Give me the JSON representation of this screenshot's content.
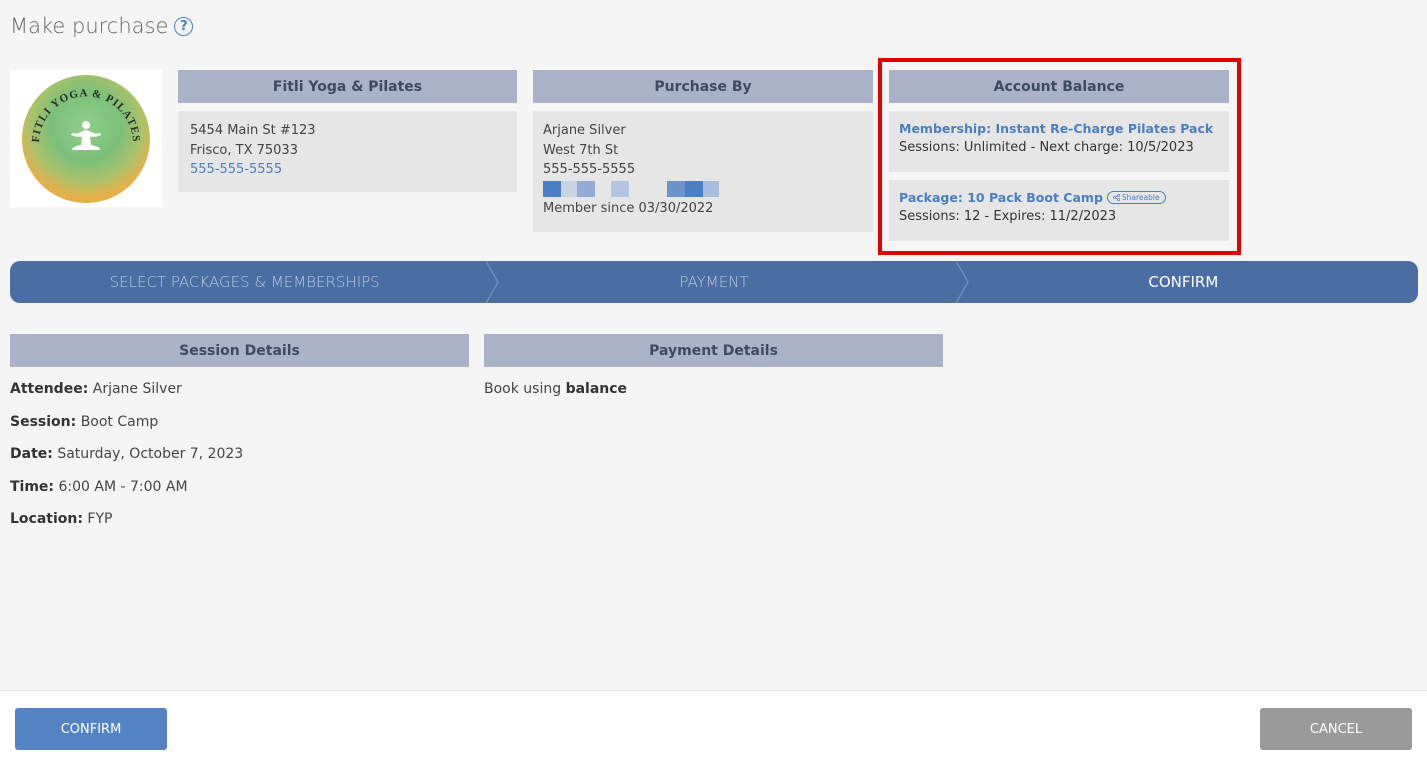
{
  "page": {
    "title": "Make purchase"
  },
  "studio": {
    "name": "Fitli Yoga & Pilates",
    "address1": "5454 Main St #123",
    "address2": "Frisco, TX 75033",
    "phone": "555-555-5555",
    "logo_text": "FITLI YOGA & PILATES"
  },
  "purchase_by": {
    "header": "Purchase By",
    "name": "Arjane Silver",
    "street": "West 7th St",
    "phone": "555-555-5555",
    "member_since": "Member since 03/30/2022"
  },
  "account_balance": {
    "header": "Account Balance",
    "items": [
      {
        "title": "Membership: Instant Re-Charge Pilates Pack",
        "detail": "Sessions: Unlimited -  Next charge: 10/5/2023"
      },
      {
        "title": "Package: 10 Pack Boot Camp",
        "badge": "Shareable",
        "detail": "Sessions: 12 -  Expires: 11/2/2023"
      }
    ]
  },
  "steps": [
    {
      "label": "SELECT PACKAGES & MEMBERSHIPS",
      "active": false
    },
    {
      "label": "PAYMENT",
      "active": false
    },
    {
      "label": "CONFIRM",
      "active": true
    }
  ],
  "session_details": {
    "header": "Session Details",
    "rows": [
      {
        "label": "Attendee:",
        "value": "Arjane Silver"
      },
      {
        "label": "Session:",
        "value": "Boot Camp"
      },
      {
        "label": "Date:",
        "value": "Saturday, October 7, 2023"
      },
      {
        "label": "Time:",
        "value": "6:00 AM - 7:00 AM"
      },
      {
        "label": "Location:",
        "value": "FYP"
      }
    ]
  },
  "payment_details": {
    "header": "Payment Details",
    "text_prefix": "Book using ",
    "text_bold": "balance"
  },
  "footer": {
    "confirm_label": "CONFIRM",
    "cancel_label": "CANCEL"
  },
  "colors": {
    "accent": "#4a7fc4",
    "stepbar": "#4a6ea3",
    "header": "#a9b2c9",
    "highlight": "#e00000",
    "cancel": "#9a9a9a"
  }
}
